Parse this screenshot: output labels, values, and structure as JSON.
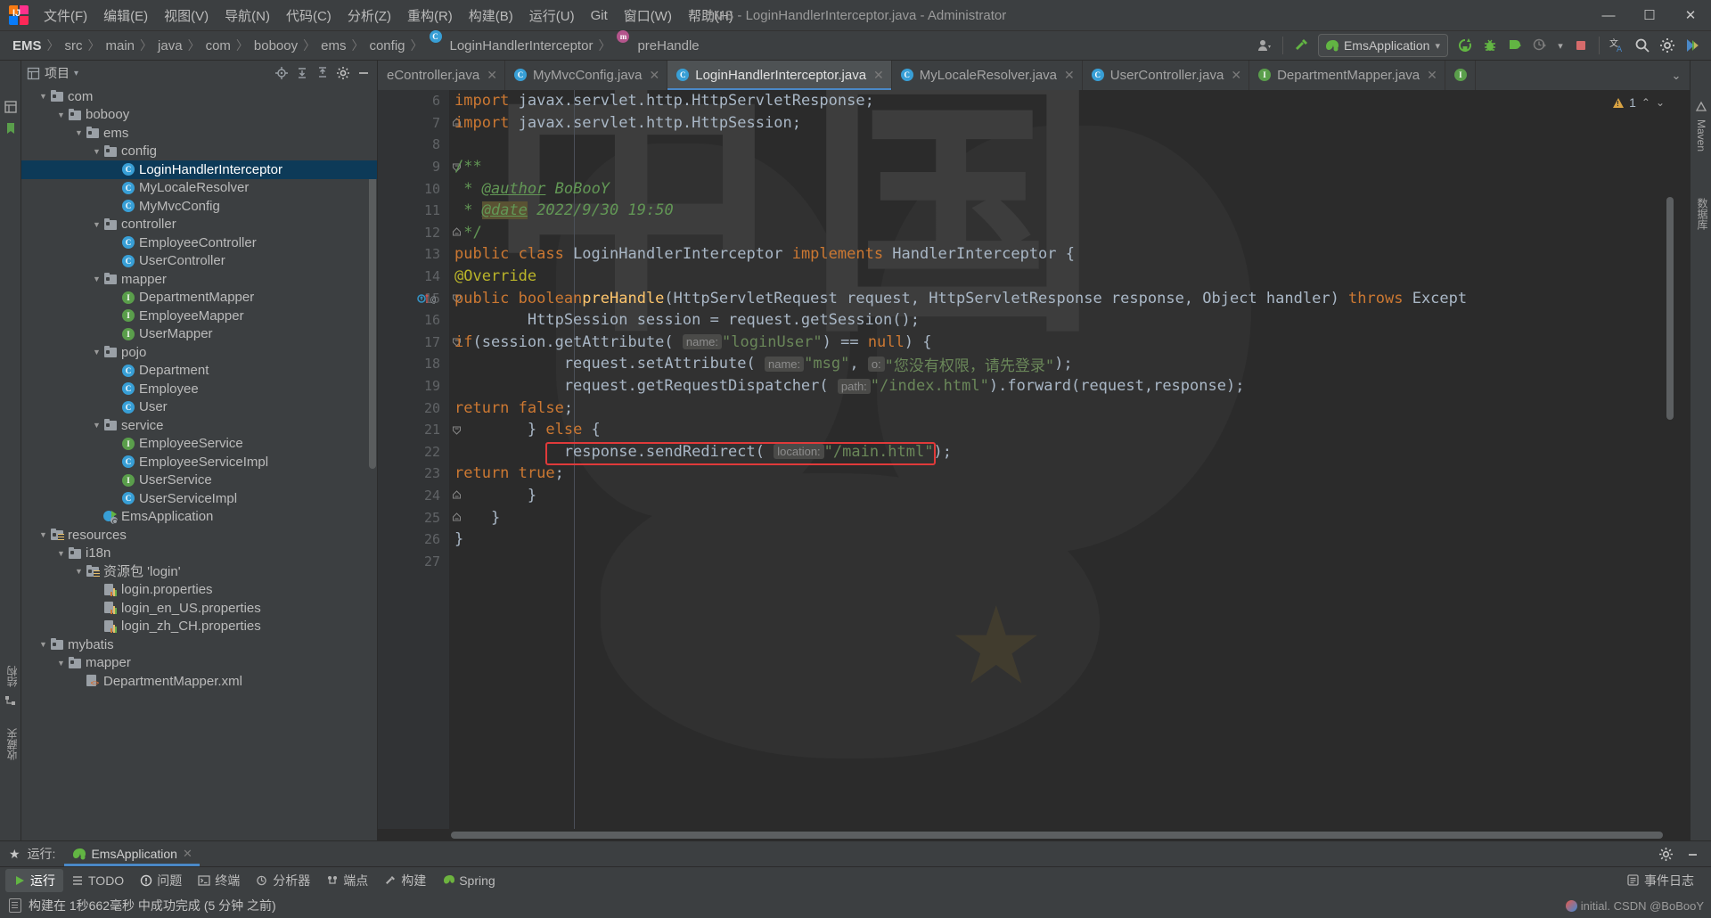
{
  "window": {
    "title": "EMS - LoginHandlerInterceptor.java - Administrator",
    "minimize": "—",
    "maximize": "☐",
    "close": "✕"
  },
  "menu": [
    {
      "label": "文件(F)"
    },
    {
      "label": "编辑(E)"
    },
    {
      "label": "视图(V)"
    },
    {
      "label": "导航(N)"
    },
    {
      "label": "代码(C)"
    },
    {
      "label": "分析(Z)"
    },
    {
      "label": "重构(R)"
    },
    {
      "label": "构建(B)"
    },
    {
      "label": "运行(U)"
    },
    {
      "label": "Git"
    },
    {
      "label": "窗口(W)"
    },
    {
      "label": "帮助(H)"
    }
  ],
  "breadcrumb": {
    "segments": [
      "EMS",
      "src",
      "main",
      "java",
      "com",
      "bobooy",
      "ems",
      "config",
      "LoginHandlerInterceptor",
      "preHandle"
    ],
    "separator": "〉",
    "class_badge": "C",
    "method_badge": "m"
  },
  "toolbar": {
    "run_config": "EmsApplication",
    "dropdown_caret": "▾",
    "icons": [
      "user-icon",
      "hammer-icon",
      "rerun-icon",
      "debug-icon",
      "run-with-coverage-icon",
      "profiler-icon",
      "stop-icon",
      "translate-icon",
      "search-icon",
      "settings-icon",
      "updates-icon"
    ]
  },
  "project_panel": {
    "title": "项目",
    "caret": "▾",
    "tools": [
      "locate-icon",
      "expand-all-icon",
      "collapse-all-icon",
      "settings-icon",
      "hide-icon"
    ],
    "tree": [
      {
        "label": "com",
        "depth": 2,
        "type": "folder",
        "arrow": "open"
      },
      {
        "label": "bobooy",
        "depth": 3,
        "type": "folder",
        "arrow": "open"
      },
      {
        "label": "ems",
        "depth": 4,
        "type": "folder",
        "arrow": "open"
      },
      {
        "label": "config",
        "depth": 5,
        "type": "folder",
        "arrow": "open"
      },
      {
        "label": "LoginHandlerInterceptor",
        "depth": 6,
        "type": "class",
        "selected": true
      },
      {
        "label": "MyLocaleResolver",
        "depth": 6,
        "type": "class"
      },
      {
        "label": "MyMvcConfig",
        "depth": 6,
        "type": "class"
      },
      {
        "label": "controller",
        "depth": 5,
        "type": "folder",
        "arrow": "open"
      },
      {
        "label": "EmployeeController",
        "depth": 6,
        "type": "class"
      },
      {
        "label": "UserController",
        "depth": 6,
        "type": "class"
      },
      {
        "label": "mapper",
        "depth": 5,
        "type": "folder",
        "arrow": "open"
      },
      {
        "label": "DepartmentMapper",
        "depth": 6,
        "type": "interface"
      },
      {
        "label": "EmployeeMapper",
        "depth": 6,
        "type": "interface"
      },
      {
        "label": "UserMapper",
        "depth": 6,
        "type": "interface"
      },
      {
        "label": "pojo",
        "depth": 5,
        "type": "folder",
        "arrow": "open"
      },
      {
        "label": "Department",
        "depth": 6,
        "type": "class"
      },
      {
        "label": "Employee",
        "depth": 6,
        "type": "class"
      },
      {
        "label": "User",
        "depth": 6,
        "type": "class"
      },
      {
        "label": "service",
        "depth": 5,
        "type": "folder",
        "arrow": "open"
      },
      {
        "label": "EmployeeService",
        "depth": 6,
        "type": "interface"
      },
      {
        "label": "EmployeeServiceImpl",
        "depth": 6,
        "type": "class"
      },
      {
        "label": "UserService",
        "depth": 6,
        "type": "interface"
      },
      {
        "label": "UserServiceImpl",
        "depth": 6,
        "type": "class"
      },
      {
        "label": "EmsApplication",
        "depth": 5,
        "type": "springboot"
      },
      {
        "label": "resources",
        "depth": 2,
        "type": "resources",
        "arrow": "open"
      },
      {
        "label": "i18n",
        "depth": 3,
        "type": "folder-plain",
        "arrow": "open"
      },
      {
        "label": "资源包 'login'",
        "depth": 4,
        "type": "resource-bundle",
        "arrow": "open"
      },
      {
        "label": "login.properties",
        "depth": 5,
        "type": "properties"
      },
      {
        "label": "login_en_US.properties",
        "depth": 5,
        "type": "properties"
      },
      {
        "label": "login_zh_CH.properties",
        "depth": 5,
        "type": "properties"
      },
      {
        "label": "mybatis",
        "depth": 2,
        "type": "folder-plain",
        "arrow": "open"
      },
      {
        "label": "mapper",
        "depth": 3,
        "type": "folder-plain",
        "arrow": "open"
      },
      {
        "label": "DepartmentMapper.xml",
        "depth": 4,
        "type": "xml"
      }
    ]
  },
  "editor_tabs": [
    {
      "label": "eController.java",
      "icon": "class-icon",
      "active": false,
      "truncated": true
    },
    {
      "label": "MyMvcConfig.java",
      "icon": "class-icon",
      "active": false
    },
    {
      "label": "LoginHandlerInterceptor.java",
      "icon": "class-icon",
      "active": true
    },
    {
      "label": "MyLocaleResolver.java",
      "icon": "class-icon",
      "active": false
    },
    {
      "label": "UserController.java",
      "icon": "class-icon",
      "active": false
    },
    {
      "label": "DepartmentMapper.java",
      "icon": "interface-icon",
      "active": false
    }
  ],
  "editor": {
    "close_glyph": "✕",
    "warning_count": "1",
    "first_line_number": 6,
    "watermark_text": "中国",
    "lines": [
      {
        "n": 6,
        "fold": "",
        "html": "<span class=\"kw\">import</span> javax.servlet.http.HttpServletResponse;"
      },
      {
        "n": 7,
        "fold": "end",
        "html": "<span class=\"kw\">import</span> javax.servlet.http.HttpSession;"
      },
      {
        "n": 8,
        "fold": "",
        "html": ""
      },
      {
        "n": 9,
        "fold": "open",
        "html": "<span class=\"cmt\">/**</span>"
      },
      {
        "n": 10,
        "fold": "",
        "html": "<span class=\"cmt\"> * <span class=\"tagdoc\">@author</span> <i>BoBooY</i></span>"
      },
      {
        "n": 11,
        "fold": "",
        "html": "<span class=\"cmt\"> * <span class=\"tagdoc hl-date\">@date</span> <i>2022/9/30 19:50</i></span>"
      },
      {
        "n": 12,
        "fold": "end",
        "html": "<span class=\"cmt\"> */</span>"
      },
      {
        "n": 13,
        "fold": "",
        "html": "<span class=\"kw\">public class</span> LoginHandlerInterceptor <span class=\"kw\">implements</span> HandlerInterceptor {"
      },
      {
        "n": 14,
        "fold": "",
        "html": "    <span class=\"anno\">@Override</span>"
      },
      {
        "n": 15,
        "fold": "open",
        "mark": "override",
        "html": "    <span class=\"kw\">public boolean</span> <span class=\"fn\">preHandle</span>(HttpServletRequest request, HttpServletResponse response, Object handler) <span class=\"kw\">throws</span> Except"
      },
      {
        "n": 16,
        "fold": "",
        "html": "        HttpSession session = request.getSession();"
      },
      {
        "n": 17,
        "fold": "open",
        "html": "        <span class=\"kw\">if</span>(session.getAttribute( <span class=\"hint\">name:</span> <span class=\"str\">\"loginUser\"</span>) == <span class=\"kw\">null</span>) {"
      },
      {
        "n": 18,
        "fold": "",
        "html": "            request.setAttribute( <span class=\"hint\">name:</span> <span class=\"str\">\"msg\"</span>, <span class=\"hint\">o:</span> <span class=\"str\">\"您没有权限，请先登录\"</span>);"
      },
      {
        "n": 19,
        "fold": "",
        "html": "            request.getRequestDispatcher( <span class=\"hint\">path:</span> <span class=\"str\">\"/index.html\"</span>).forward(request,response);"
      },
      {
        "n": 20,
        "fold": "",
        "html": "            <span class=\"kw\">return false</span>;"
      },
      {
        "n": 21,
        "fold": "open",
        "html": "        } <span class=\"kw\">else</span> {"
      },
      {
        "n": 22,
        "fold": "",
        "highlight": true,
        "html": "            response.sendRedirect( <span class=\"hint\">location:</span> <span class=\"str\">\"/main.html\"</span>);"
      },
      {
        "n": 23,
        "fold": "",
        "html": "            <span class=\"kw\">return true</span>;"
      },
      {
        "n": 24,
        "fold": "end",
        "html": "        }"
      },
      {
        "n": 25,
        "fold": "end",
        "html": "    }"
      },
      {
        "n": 26,
        "fold": "",
        "html": "}"
      },
      {
        "n": 27,
        "fold": "",
        "html": ""
      }
    ]
  },
  "run_panel": {
    "label": "运行:",
    "tab": "EmsApplication",
    "close_glyph": "✕",
    "settings_icon": "gear-icon",
    "minimize_icon": "minimize-icon"
  },
  "status_tools": [
    {
      "label": "运行",
      "icon": "run-icon",
      "active": true
    },
    {
      "label": "TODO",
      "icon": "todo-icon",
      "active": false
    },
    {
      "label": "问题",
      "icon": "problems-icon",
      "active": false
    },
    {
      "label": "终端",
      "icon": "terminal-icon",
      "active": false
    },
    {
      "label": "分析器",
      "icon": "profiler-icon",
      "active": false
    },
    {
      "label": "端点",
      "icon": "endpoints-icon",
      "active": false
    },
    {
      "label": "构建",
      "icon": "build-icon",
      "active": false
    },
    {
      "label": "Spring",
      "icon": "spring-icon",
      "active": false
    }
  ],
  "status_right": {
    "event_log": "事件日志"
  },
  "build_message": "构建在 1秒662毫秒 中成功完成 (5 分钟 之前)",
  "watermark_credit": "initial. CSDN @BoBooY",
  "right_strip": [
    {
      "label": "Maven"
    },
    {
      "label": "数据库"
    }
  ],
  "left_strip": [
    {
      "label": "结构"
    },
    {
      "label": "收藏夹"
    }
  ]
}
